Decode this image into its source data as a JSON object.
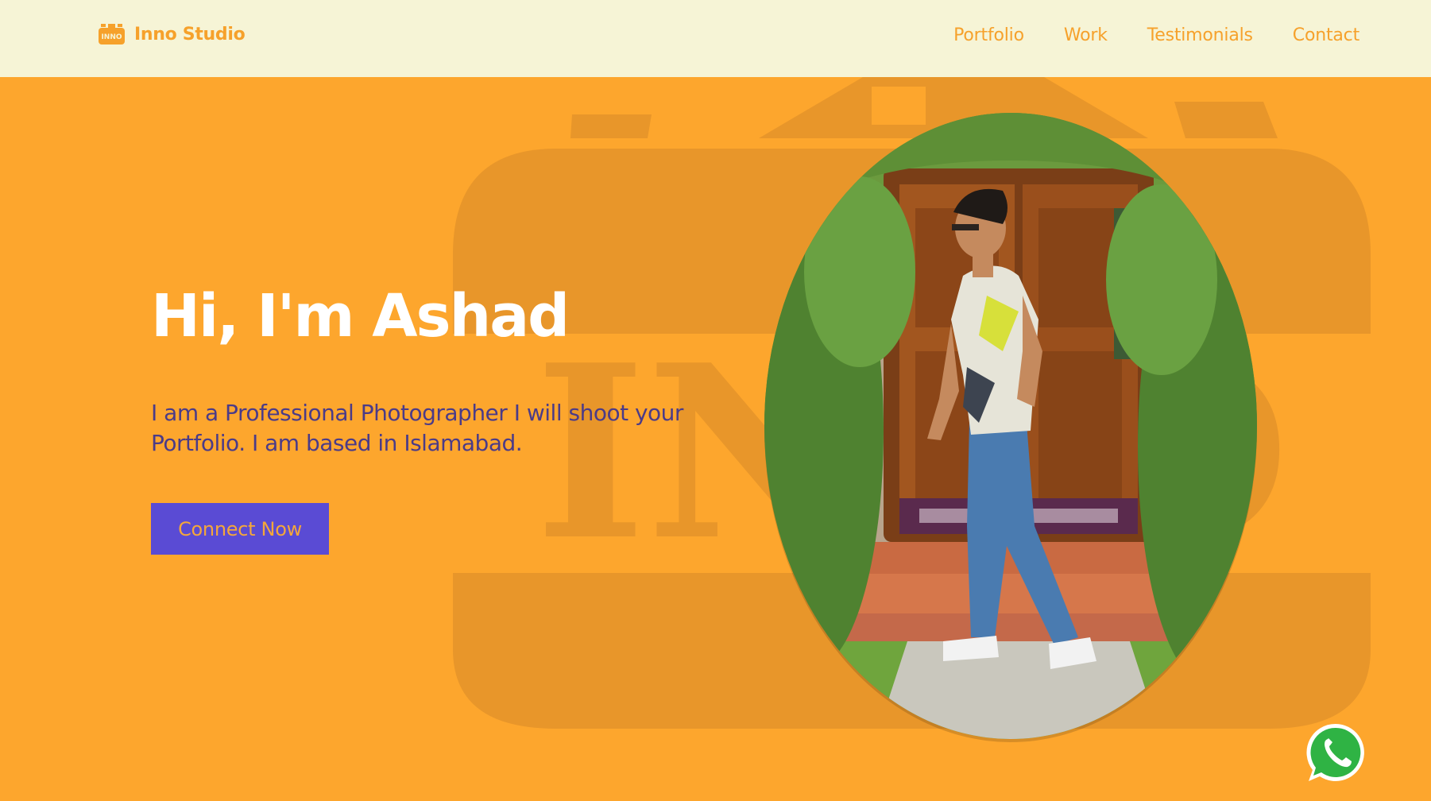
{
  "header": {
    "brand_name": "Inno Studio",
    "brand_logo_text": "INNO",
    "nav": [
      {
        "label": "Portfolio"
      },
      {
        "label": "Work"
      },
      {
        "label": "Testimonials"
      },
      {
        "label": "Contact"
      }
    ]
  },
  "hero": {
    "title": "Hi, I'm Ashad",
    "description": "I am a Professional Photographer I will shoot your Portfolio. I am based in Islamabad.",
    "cta_label": "Connect Now",
    "watermark_text": "INNO",
    "portrait_icon": "person-photo"
  },
  "floating": {
    "whatsapp_icon": "whatsapp-icon"
  },
  "colors": {
    "header_bg": "#f6f4d6",
    "hero_bg": "#fda62d",
    "brand_accent": "#f6a12b",
    "cta_bg": "#5a4bd4",
    "cta_text": "#f4a73a",
    "title_text": "#ffffff",
    "desc_text": "#4b3b88",
    "whatsapp_green": "#2fb344"
  }
}
